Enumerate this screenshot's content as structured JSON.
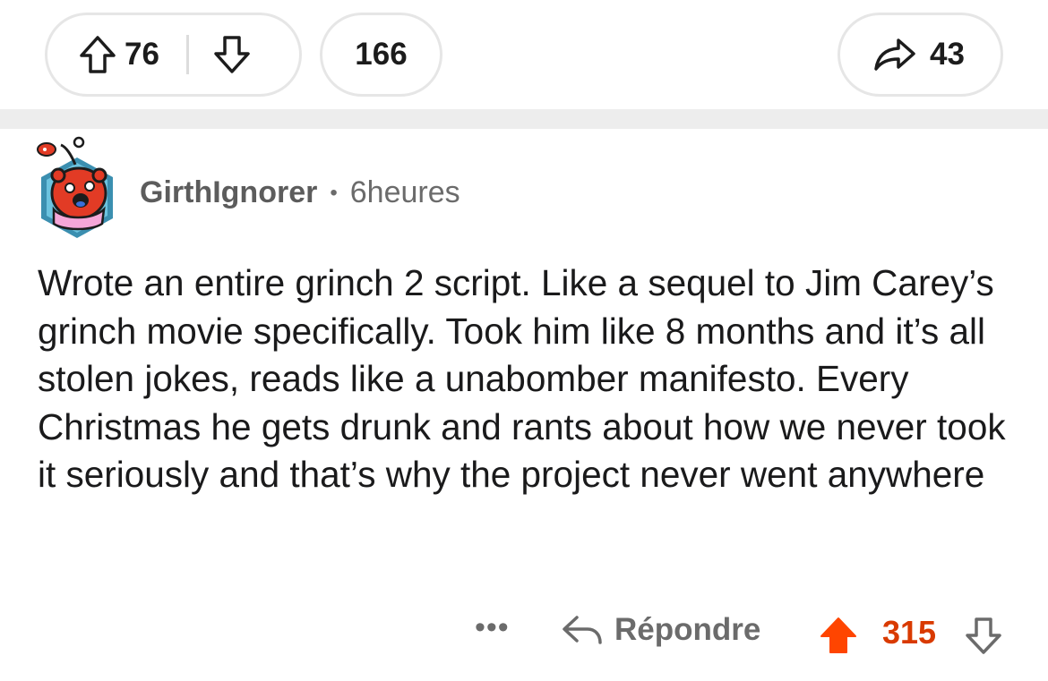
{
  "post_actions": {
    "upvote_count": "76",
    "comment_count": "166",
    "share_count": "43"
  },
  "comment": {
    "author": "GirthIgnorer",
    "separator": "•",
    "time": "6heures",
    "body": "Wrote an entire grinch 2 script. Like a sequel to Jim Carey’s grinch movie specifically. Took him like 8 months and it’s all stolen jokes, reads like a unabomber manifesto. Every Christmas he gets drunk and rants about how we never took it seriously and that’s why the project never went anywhere",
    "more_label": "•••",
    "reply_label": "Répondre",
    "score": "315"
  },
  "icons": {
    "upvote": "arrow-up-outline-icon",
    "downvote": "arrow-down-outline-icon",
    "share": "share-arrow-icon",
    "reply": "reply-arrow-icon",
    "upvote_active": "arrow-up-filled-icon"
  },
  "colors": {
    "accent_upvote": "#ff4500",
    "score_text": "#d93a00",
    "muted_text": "#6b6b6b",
    "pill_border": "#e6e6e6",
    "separator_band": "#ededed"
  }
}
